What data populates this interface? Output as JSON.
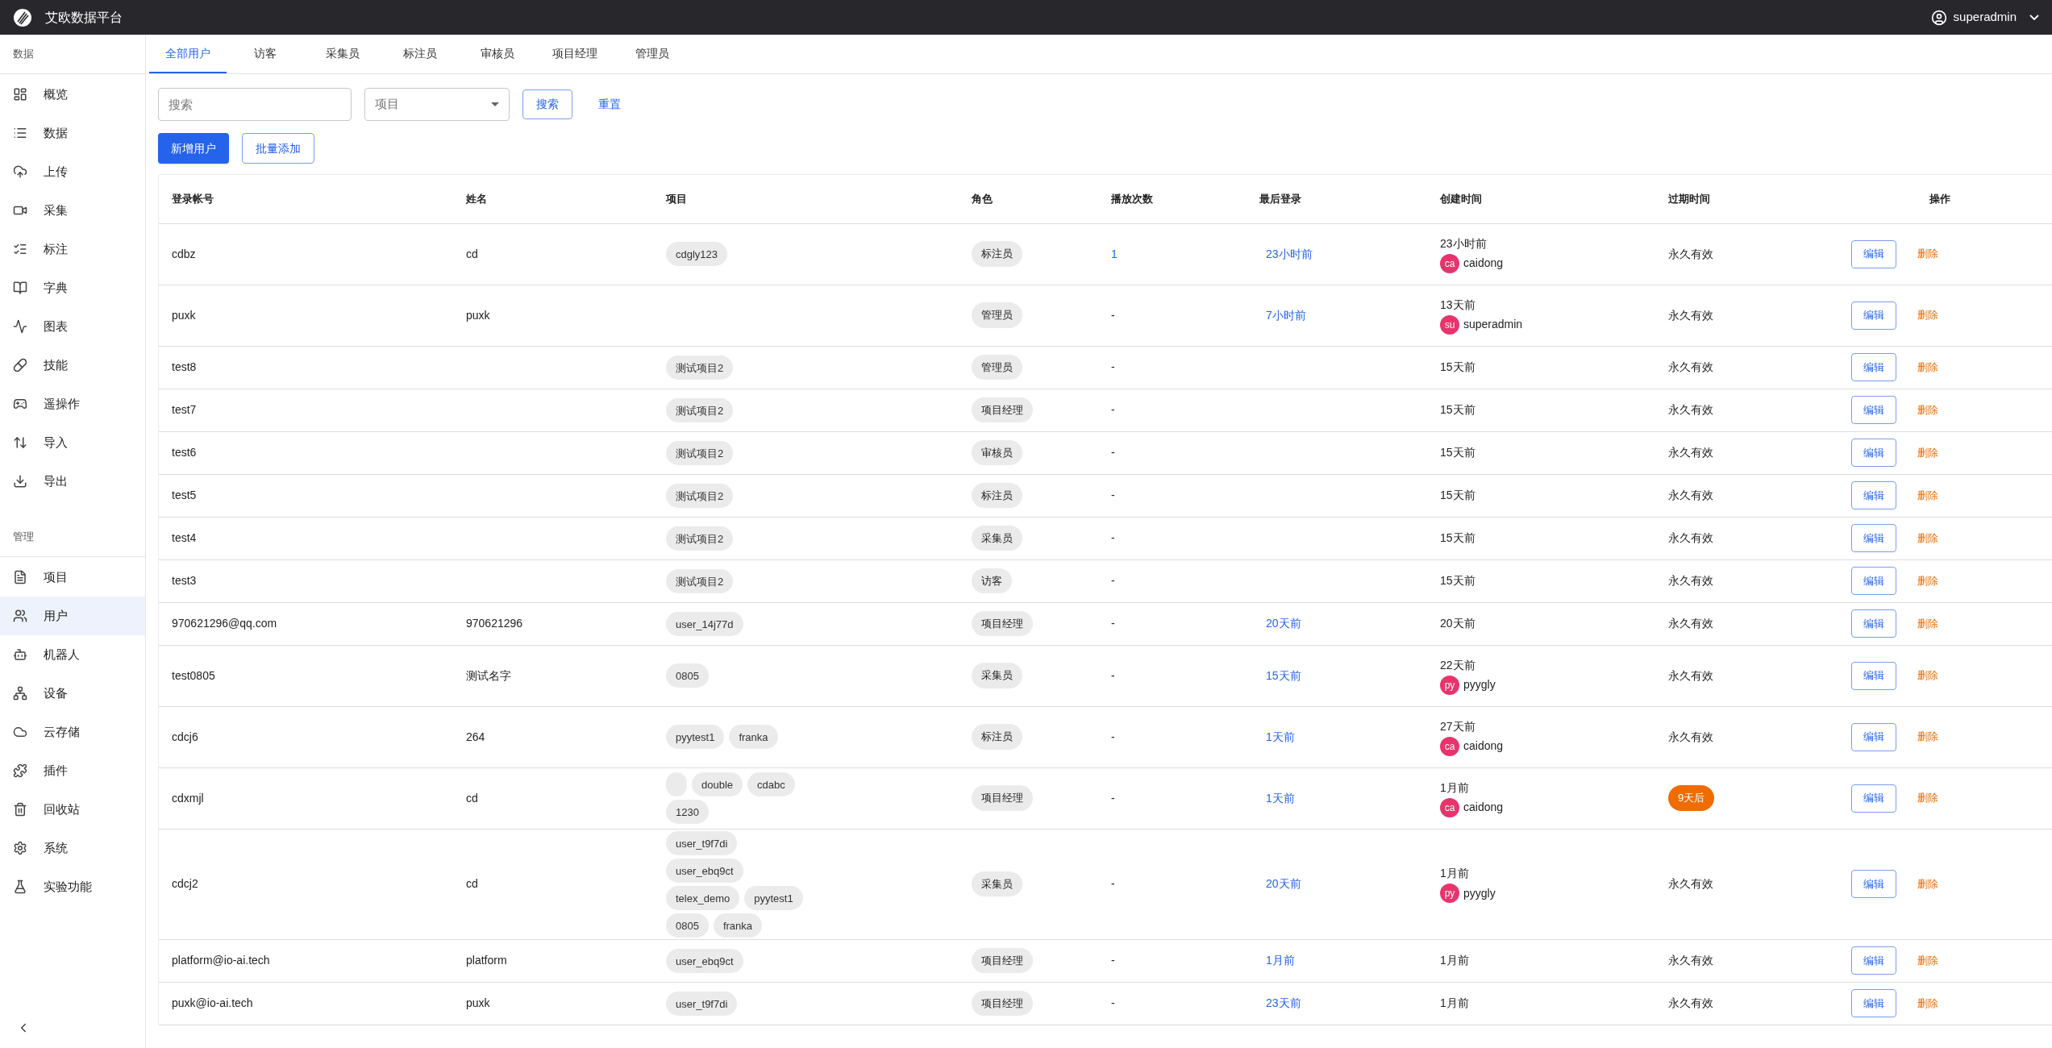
{
  "header": {
    "title": "艾欧数据平台",
    "user": "superadmin"
  },
  "sidebar": {
    "sections": [
      {
        "label": "数据",
        "items": [
          {
            "label": "概览",
            "selected": false
          },
          {
            "label": "数据",
            "selected": false
          },
          {
            "label": "上传",
            "selected": false
          },
          {
            "label": "采集",
            "selected": false
          },
          {
            "label": "标注",
            "selected": false
          },
          {
            "label": "字典",
            "selected": false
          },
          {
            "label": "图表",
            "selected": false
          },
          {
            "label": "技能",
            "selected": false
          },
          {
            "label": "遥操作",
            "selected": false
          },
          {
            "label": "导入",
            "selected": false
          },
          {
            "label": "导出",
            "selected": false
          }
        ]
      },
      {
        "label": "管理",
        "items": [
          {
            "label": "项目",
            "selected": false
          },
          {
            "label": "用户",
            "selected": true
          },
          {
            "label": "机器人",
            "selected": false
          },
          {
            "label": "设备",
            "selected": false
          },
          {
            "label": "云存储",
            "selected": false
          },
          {
            "label": "插件",
            "selected": false
          },
          {
            "label": "回收站",
            "selected": false
          },
          {
            "label": "系统",
            "selected": false
          },
          {
            "label": "实验功能",
            "selected": false
          }
        ]
      }
    ]
  },
  "tabs": [
    {
      "label": "全部用户",
      "selected": true
    },
    {
      "label": "访客",
      "selected": false
    },
    {
      "label": "采集员",
      "selected": false
    },
    {
      "label": "标注员",
      "selected": false
    },
    {
      "label": "审核员",
      "selected": false
    },
    {
      "label": "项目经理",
      "selected": false
    },
    {
      "label": "管理员",
      "selected": false
    }
  ],
  "filters": {
    "search_placeholder": "搜索",
    "project_placeholder": "项目",
    "search_button": "搜索",
    "reset_button": "重置"
  },
  "actions": {
    "add": "新增用户",
    "batch_add": "批量添加"
  },
  "table": {
    "columns": [
      "登录帐号",
      "姓名",
      "项目",
      "角色",
      "播放次数",
      "最后登录",
      "创建时间",
      "过期时间",
      "操作"
    ],
    "rows": [
      {
        "account": "cdbz",
        "name": "cd",
        "projects": [
          "cdgly123"
        ],
        "role": "标注员",
        "plays": "1",
        "plays_linked": true,
        "last_login": "23小时前",
        "created": "23小时前",
        "creator": {
          "initials": "ca",
          "name": "caidong"
        },
        "expire": "永久有效",
        "expire_soon": false,
        "edit": "编辑",
        "delete": "删除"
      },
      {
        "account": "puxk",
        "name": "puxk",
        "projects": [],
        "role": "管理员",
        "plays": "-",
        "plays_linked": false,
        "last_login": "7小时前",
        "created": "13天前",
        "creator": {
          "initials": "su",
          "name": "superadmin"
        },
        "expire": "永久有效",
        "expire_soon": false,
        "edit": "编辑",
        "delete": "删除"
      },
      {
        "account": "test8",
        "projects": [
          "测试项目2"
        ],
        "role": "管理员",
        "plays": "-",
        "plays_linked": false,
        "created": "15天前",
        "expire": "永久有效",
        "expire_soon": false,
        "edit": "编辑",
        "delete": "删除"
      },
      {
        "account": "test7",
        "projects": [
          "测试项目2"
        ],
        "role": "项目经理",
        "plays": "-",
        "plays_linked": false,
        "created": "15天前",
        "expire": "永久有效",
        "expire_soon": false,
        "edit": "编辑",
        "delete": "删除"
      },
      {
        "account": "test6",
        "projects": [
          "测试项目2"
        ],
        "role": "审核员",
        "plays": "-",
        "plays_linked": false,
        "created": "15天前",
        "expire": "永久有效",
        "expire_soon": false,
        "edit": "编辑",
        "delete": "删除"
      },
      {
        "account": "test5",
        "projects": [
          "测试项目2"
        ],
        "role": "标注员",
        "plays": "-",
        "plays_linked": false,
        "created": "15天前",
        "expire": "永久有效",
        "expire_soon": false,
        "edit": "编辑",
        "delete": "删除"
      },
      {
        "account": "test4",
        "projects": [
          "测试项目2"
        ],
        "role": "采集员",
        "plays": "-",
        "plays_linked": false,
        "created": "15天前",
        "expire": "永久有效",
        "expire_soon": false,
        "edit": "编辑",
        "delete": "删除"
      },
      {
        "account": "test3",
        "projects": [
          "测试项目2"
        ],
        "role": "访客",
        "plays": "-",
        "plays_linked": false,
        "created": "15天前",
        "expire": "永久有效",
        "expire_soon": false,
        "edit": "编辑",
        "delete": "删除"
      },
      {
        "account": "970621296@qq.com",
        "name": "970621296",
        "projects": [
          "user_14j77d"
        ],
        "role": "项目经理",
        "plays": "-",
        "plays_linked": false,
        "last_login": "20天前",
        "created": "20天前",
        "expire": "永久有效",
        "expire_soon": false,
        "edit": "编辑",
        "delete": "删除"
      },
      {
        "account": "test0805",
        "name": "测试名字",
        "projects": [
          "0805"
        ],
        "role": "采集员",
        "plays": "-",
        "plays_linked": false,
        "last_login": "15天前",
        "created": "22天前",
        "creator": {
          "initials": "py",
          "name": "pyygly"
        },
        "expire": "永久有效",
        "expire_soon": false,
        "edit": "编辑",
        "delete": "删除"
      },
      {
        "account": "cdcj6",
        "name": "264",
        "projects": [
          "pyytest1",
          "franka"
        ],
        "role": "标注员",
        "plays": "-",
        "plays_linked": false,
        "last_login": "1天前",
        "created": "27天前",
        "creator": {
          "initials": "ca",
          "name": "caidong"
        },
        "expire": "永久有效",
        "expire_soon": false,
        "edit": "编辑",
        "delete": "删除"
      },
      {
        "account": "cdxmjl",
        "name": "cd",
        "projects": [
          {
            "kind": "blank"
          },
          "double",
          "cdabc",
          "1230"
        ],
        "role": "项目经理",
        "plays": "-",
        "plays_linked": false,
        "last_login": "1天前",
        "created": "1月前",
        "creator": {
          "initials": "ca",
          "name": "caidong"
        },
        "expire": "9天后",
        "expire_soon": true,
        "edit": "编辑",
        "delete": "删除"
      },
      {
        "account": "cdcj2",
        "name": "cd",
        "projects": [
          "user_t9f7di",
          "user_ebq9ct",
          "telex_demo",
          "pyytest1",
          "0805",
          "franka"
        ],
        "role": "采集员",
        "plays": "-",
        "plays_linked": false,
        "last_login": "20天前",
        "created": "1月前",
        "creator": {
          "initials": "py",
          "name": "pyygly"
        },
        "expire": "永久有效",
        "expire_soon": false,
        "edit": "编辑",
        "delete": "删除"
      },
      {
        "account": "platform@io-ai.tech",
        "name": "platform",
        "projects": [
          "user_ebq9ct"
        ],
        "role": "项目经理",
        "plays": "-",
        "plays_linked": false,
        "last_login": "1月前",
        "created": "1月前",
        "expire": "永久有效",
        "expire_soon": false,
        "edit": "编辑",
        "delete": "删除"
      },
      {
        "account": "puxk@io-ai.tech",
        "name": "puxk",
        "projects": [
          "user_t9f7di"
        ],
        "role": "项目经理",
        "plays": "-",
        "plays_linked": false,
        "last_login": "23天前",
        "created": "1月前",
        "expire": "永久有效",
        "expire_soon": false,
        "edit": "编辑",
        "delete": "删除"
      }
    ]
  }
}
